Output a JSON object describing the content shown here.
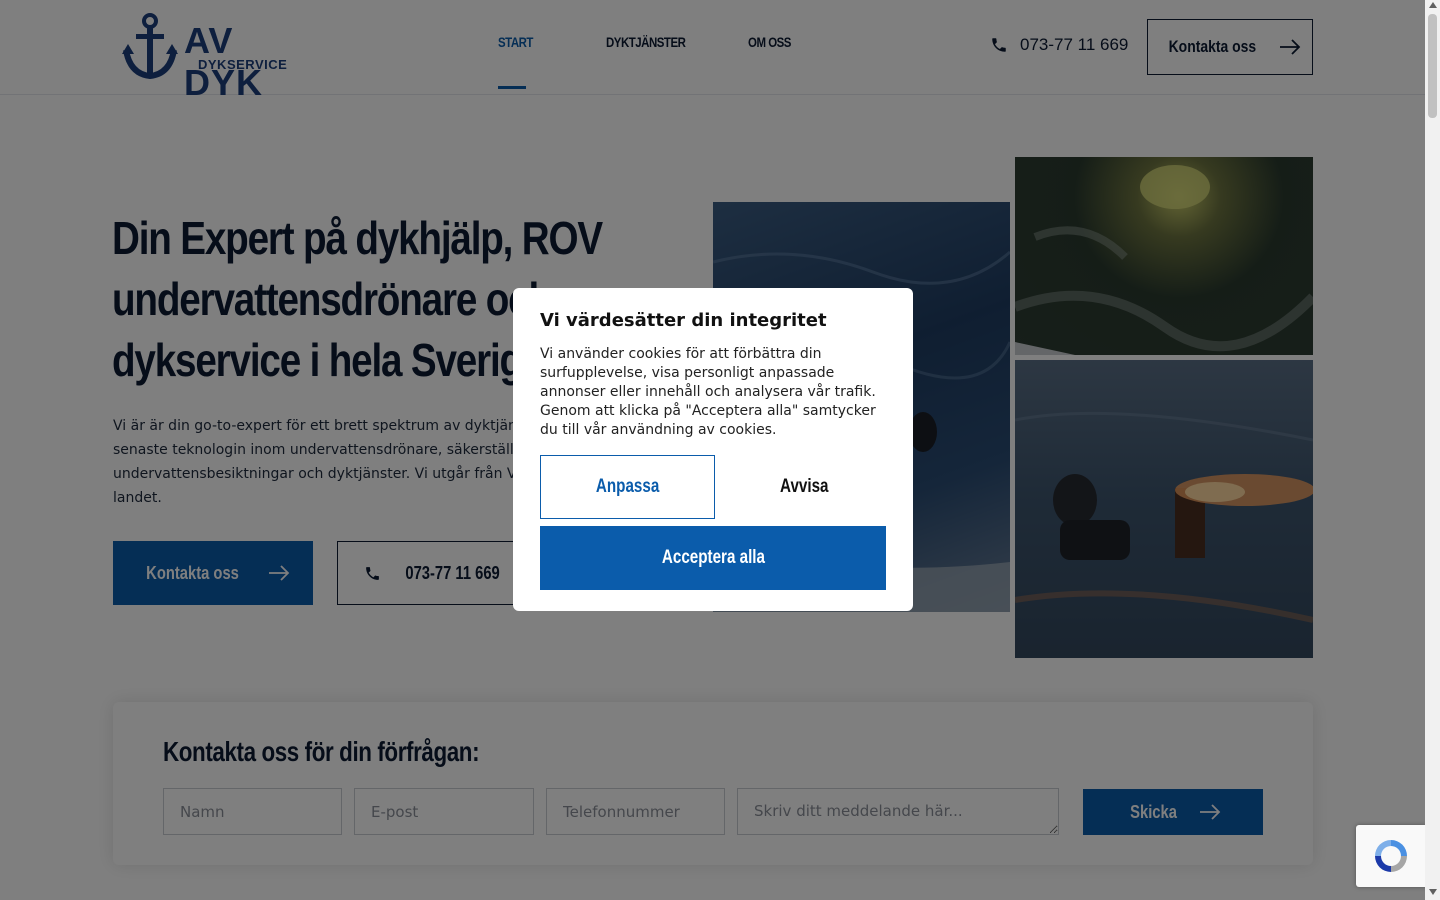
{
  "header": {
    "logo_title": "AV DYK",
    "logo_subtitle": "DYKSERVICE",
    "nav": [
      {
        "label": "START",
        "active": true
      },
      {
        "label": "DYKTJÄNSTER",
        "active": false
      },
      {
        "label": "OM OSS",
        "active": false
      }
    ],
    "phone": "073-77 11 669",
    "cta_label": "Kontakta oss"
  },
  "hero": {
    "title": "Din Expert på dykhjälp, ROV undervattensdrönare och dykservice i hela Sverige",
    "text": "Vi är är din go-to-expert för ett brett spektrum av dyktjänster. Vi använder den senaste teknologin inom undervattensdrönare, säkerställer noggranna och effektiva undervattensbesiktningar och dyktjänster. Vi utgår från Västerås men arbetar i hela landet.",
    "primary_button": "Kontakta oss",
    "phone_button": "073-77 11 669"
  },
  "contact_form": {
    "title": "Kontakta oss för din förfrågan:",
    "name_placeholder": "Namn",
    "email_placeholder": "E-post",
    "phone_placeholder": "Telefonnummer",
    "message_placeholder": "Skriv ditt meddelande här...",
    "submit_label": "Skicka"
  },
  "cookie_modal": {
    "title": "Vi värdesätter din integritet",
    "text": "Vi använder cookies för att förbättra din surfupplevelse, visa personligt anpassade annonser eller innehåll och analysera vår trafik. Genom att klicka på \"Acceptera alla\" samtycker du till vår användning av cookies.",
    "customize_label": "Anpassa",
    "reject_label": "Avvisa",
    "accept_label": "Acceptera alla"
  },
  "colors": {
    "brand_blue": "#0b5cab",
    "dark_navy": "#0c1a33",
    "logo_blue": "#1c3f7c"
  }
}
